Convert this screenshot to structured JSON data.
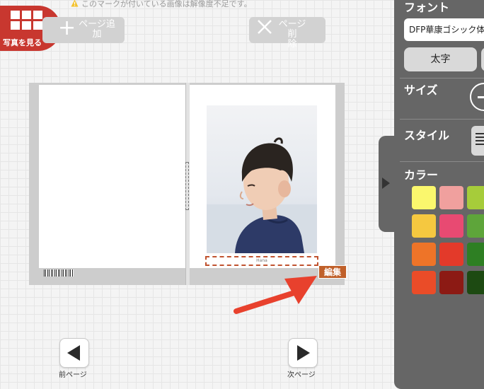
{
  "notice": {
    "text": "このマークが付いている画像は解像度不足です。"
  },
  "view_photos": {
    "label": "写真を見る"
  },
  "add_page": {
    "line1": "ページ追",
    "line2": "加"
  },
  "delete_page": {
    "line1": "ページ削",
    "line2": "除"
  },
  "caption": {
    "text": "Hana"
  },
  "edit": {
    "label": "編集"
  },
  "nav": {
    "prev_label": "前ページ",
    "next_label": "次ページ"
  },
  "panel": {
    "font_title": "フォント",
    "font_value": "DFP華康ゴシック体",
    "bold_label": "太字",
    "size_title": "サイズ",
    "style_title": "スタイル",
    "color_title": "カラー",
    "swatches": [
      "#faf76d",
      "#f0a09e",
      "#a6cc3a",
      "#f5c840",
      "#e84a72",
      "#5ea53a",
      "#ee7428",
      "#e33a2a",
      "#2e7f23",
      "#ea4c28",
      "#8c1a14",
      "#1d4a12"
    ]
  },
  "colors": {
    "accent": "#c8372f",
    "panel": "#666666",
    "edit": "#c0602a",
    "arrow": "#e8412d"
  }
}
